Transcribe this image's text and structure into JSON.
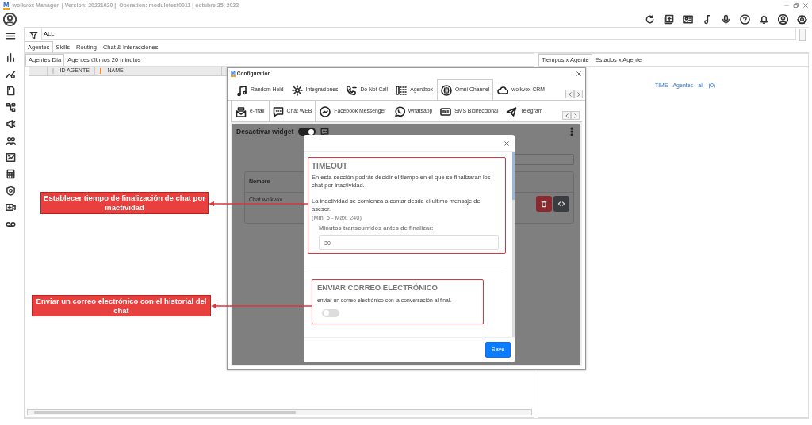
{
  "app_bar": {
    "logo": "M",
    "title": "wolkvox Manager  | Version: 20221020 |  Operation: modulotest0011 | octubre 25, 2022"
  },
  "filter": {
    "value": "ALL"
  },
  "main_tabs": [
    {
      "label": "Agentes",
      "selected": true
    },
    {
      "label": "Skills",
      "selected": false
    },
    {
      "label": "Routing",
      "selected": false
    },
    {
      "label": "Chat & Interacciones",
      "selected": false
    }
  ],
  "sub_tabs": [
    {
      "label": "Agentes Día",
      "selected": true
    },
    {
      "label": "Agentes últimos 20 minutos",
      "selected": false
    }
  ],
  "agents_table": {
    "columns": [
      "ID AGENTE",
      "NAME"
    ]
  },
  "right_panel": {
    "tabs": [
      {
        "label": "Tiempos x Agente",
        "selected": true
      },
      {
        "label": "Estados x Agente",
        "selected": false
      }
    ],
    "summary": "TIME - Agentes - all - (0)"
  },
  "config_window": {
    "logo": "M",
    "title": "Configuration",
    "modules": [
      {
        "kind": "music",
        "label": "Random Hold",
        "selected": false
      },
      {
        "kind": "gear",
        "label": "Integraciones",
        "selected": false
      },
      {
        "kind": "phone",
        "label": "Do Not Call",
        "selected": false
      },
      {
        "kind": "keypad",
        "label": "Agentbox",
        "selected": false
      },
      {
        "kind": "omni",
        "label": "Omni Channel",
        "selected": true
      },
      {
        "kind": "cloud",
        "label": "wolkvox CRM",
        "selected": false
      }
    ],
    "channels": [
      {
        "kind": "mail",
        "label": "e-mail",
        "selected": false
      },
      {
        "kind": "chat",
        "label": "Chat WEB",
        "selected": true
      },
      {
        "kind": "messenger",
        "label": "Facebook Messenger",
        "selected": false
      },
      {
        "kind": "whatsapp",
        "label": "Whatsapp",
        "selected": false
      },
      {
        "kind": "sms",
        "label": "SMS Bidireccional",
        "selected": false
      },
      {
        "kind": "plane",
        "label": "Telegram",
        "selected": false
      }
    ],
    "widget": {
      "label": "Desactivar widget",
      "on": true
    },
    "table": {
      "columns": [
        "Nombre"
      ],
      "rows": [
        {
          "name": "Chat wolkvox"
        }
      ]
    }
  },
  "modal": {
    "timeout": {
      "title": "TIMEOUT",
      "description": "En esta sección podrás decidir el tiempo en el que se finalizaran los chat por inactividad.",
      "note": "La inactividad se comienza a contar desde el ultimo mensaje del asesor.",
      "range": "(Min. 5 - Max. 240)",
      "field_label": "Minutos transcurridos antes de finalizar:",
      "value": "30"
    },
    "email": {
      "title": "ENVIAR CORREO ELECTRÓNICO",
      "description": "enviar un correo electrónico con la conversación al final.",
      "on": false
    },
    "save": "Save"
  },
  "callouts": [
    {
      "text": "Establecer tiempo de finalización de chat por inactividad"
    },
    {
      "text": "Enviar un correo electrónico con el historial del chat"
    }
  ]
}
